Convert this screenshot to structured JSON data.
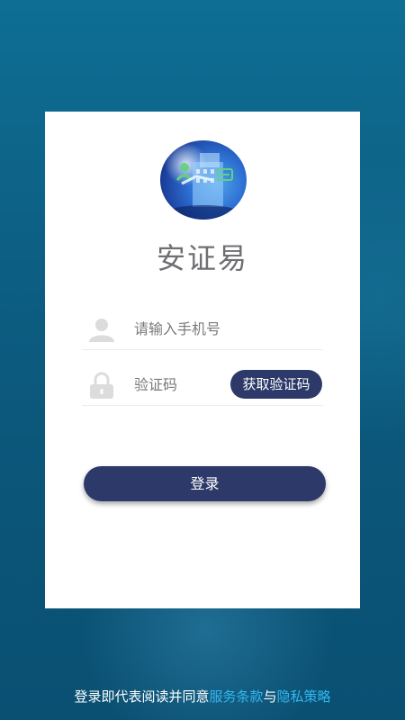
{
  "app": {
    "title": "安证易",
    "logo_icon": "building-handshake-logo"
  },
  "form": {
    "phone": {
      "icon": "user-icon",
      "placeholder": "请输入手机号",
      "value": ""
    },
    "code": {
      "icon": "lock-icon",
      "placeholder": "验证码",
      "value": ""
    },
    "get_code_label": "获取验证码",
    "login_label": "登录"
  },
  "agreement": {
    "prefix": "登录即代表阅读并同意",
    "terms_link": "服务条款",
    "and": "与",
    "privacy_link": "隐私策略"
  },
  "colors": {
    "background": "#0b5a7e",
    "card": "#ffffff",
    "primary_button": "#2c3969",
    "link": "#33b7f0"
  }
}
